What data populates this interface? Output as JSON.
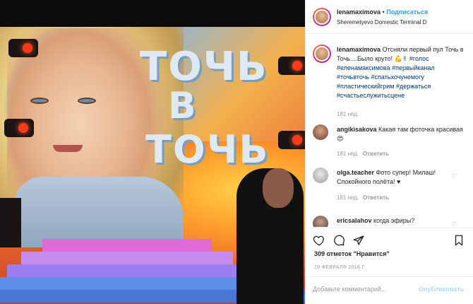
{
  "photo": {
    "logo_line1": "ТОЧЬ",
    "logo_line2": "В",
    "logo_line3": "ТОЧЬ"
  },
  "header": {
    "username": "lenamaximova",
    "separator": "•",
    "follow_label": "Подписаться",
    "location": "Sheremetyevo Domestic Terminal D"
  },
  "caption": {
    "username": "lenamaximova",
    "text": "Отсняли первый пул Точь в Точь....Было круто! 💪✌",
    "hashtags": "#голос #еленамаксимова #первыйканал #точьвточь #спатьхочунемогу #пластическийгрим #держаться #счастьеслужитьсцене",
    "time": "181 нед."
  },
  "comments": [
    {
      "username": "angikisakova",
      "text": "Какая там фоточка красивая 😍",
      "time": "181 нед.",
      "reply": "Ответить"
    },
    {
      "username": "olga.teacher",
      "text": "Фото супер! Милаш! Спокойного полёта! ♥",
      "time": "181 нед.",
      "reply": "Ответить"
    },
    {
      "username": "ericsalahov",
      "text": "когда эфиры?"
    }
  ],
  "actions": {
    "likes": "309 отметок \"Нравится\"",
    "date": "20 ФЕВРАЛЯ 2016 Г.",
    "comment_placeholder": "Добавьте комментарий...",
    "publish_label": "Опубликовать"
  },
  "icons": [
    "heart-icon",
    "comment-icon",
    "share-icon",
    "bookmark-icon",
    "like-comment-heart-icon"
  ],
  "colors": {
    "link": "#3897f0",
    "hashtag": "#003569",
    "muted": "#999999",
    "text": "#262626"
  }
}
